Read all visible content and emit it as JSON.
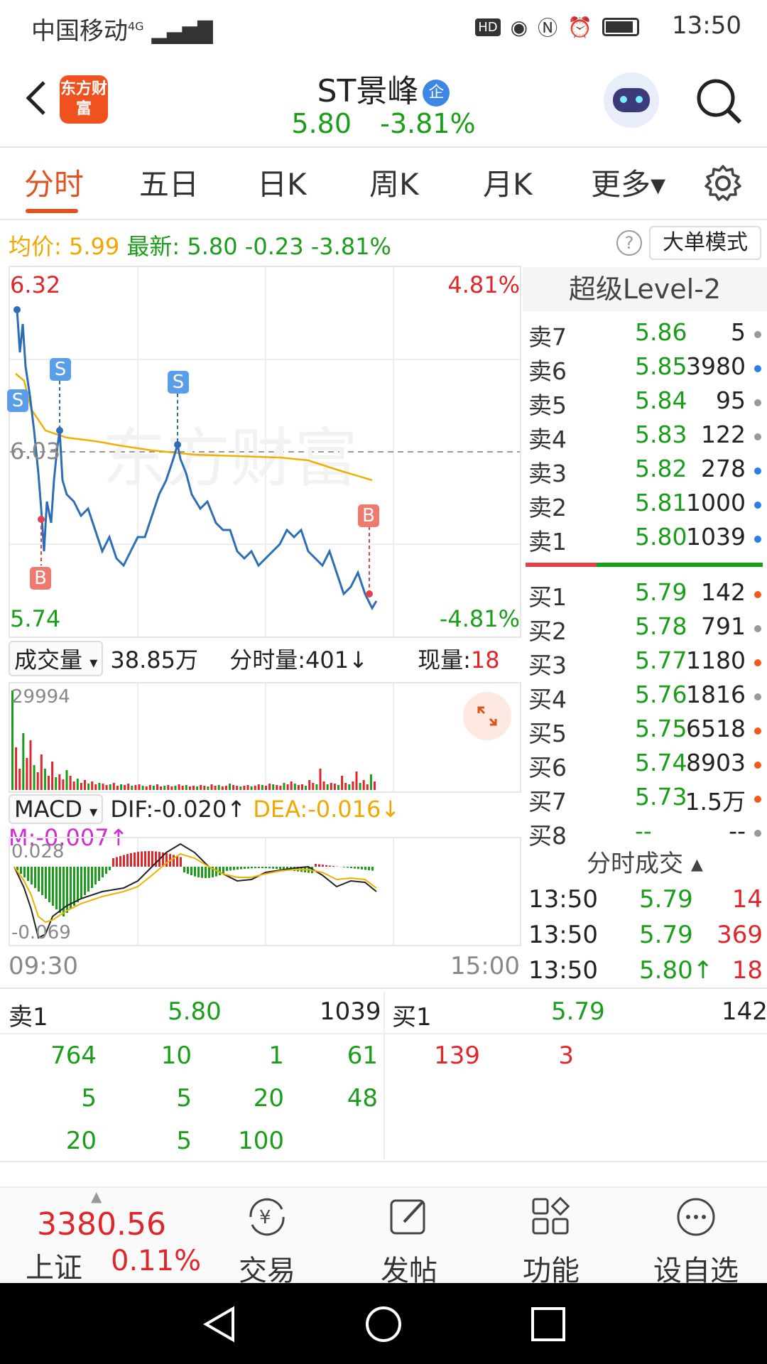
{
  "status_bar": {
    "carrier": "中国移动",
    "network": "4G",
    "time": "13:50"
  },
  "header": {
    "logo_text": "东方财富",
    "stock_name": "ST景峰",
    "badge": "企",
    "price": "5.80",
    "change_pct": "-3.81%"
  },
  "tabs": [
    {
      "label": "分时",
      "active": true
    },
    {
      "label": "五日"
    },
    {
      "label": "日K"
    },
    {
      "label": "周K"
    },
    {
      "label": "月K"
    },
    {
      "label": "更多▾"
    }
  ],
  "info_row": {
    "avg_label": "均价:",
    "avg_value": "5.99",
    "latest_label": "最新:",
    "latest_value": "5.80",
    "change": "-0.23",
    "change_pct": "-3.81%",
    "help": "?",
    "big_order_btn": "大单模式"
  },
  "chart": {
    "high_price": "6.32",
    "high_pct": "4.81%",
    "mid_price": "6.03",
    "low_price": "5.74",
    "low_pct": "-4.81%",
    "watermark": "东方财富",
    "markers": [
      "S",
      "S",
      "S",
      "B",
      "B"
    ],
    "time_start": "09:30",
    "time_end": "15:00"
  },
  "chart_data": {
    "type": "line",
    "series": [],
    "ylim": [
      5.74,
      6.32
    ],
    "reference": 6.03
  },
  "volume": {
    "dropdown": "成交量",
    "total": "38.85万",
    "minute_label": "分时量:",
    "minute_value": "401",
    "minute_arrow": "↓",
    "current_label": "现量:",
    "current_value": "18",
    "max_label": "29994"
  },
  "macd": {
    "dropdown": "MACD",
    "dif": "DIF:-0.020",
    "dif_arrow": "↑",
    "dea": "DEA:-0.016",
    "dea_arrow": "↓",
    "m": "M:-0.007",
    "m_arrow": "↑",
    "top_label": "0.028",
    "bottom_label": "-0.069"
  },
  "level2": {
    "title": "超级Level-2",
    "asks": [
      {
        "label": "卖7",
        "price": "5.86",
        "vol": "5",
        "dot": "#999999"
      },
      {
        "label": "卖6",
        "price": "5.85",
        "vol": "3980",
        "dot": "#2f7de1"
      },
      {
        "label": "卖5",
        "price": "5.84",
        "vol": "95",
        "dot": "#999999"
      },
      {
        "label": "卖4",
        "price": "5.83",
        "vol": "122",
        "dot": "#999999"
      },
      {
        "label": "卖3",
        "price": "5.82",
        "vol": "278",
        "dot": "#2f7de1"
      },
      {
        "label": "卖2",
        "price": "5.81",
        "vol": "1000",
        "dot": "#2f7de1"
      },
      {
        "label": "卖1",
        "price": "5.80",
        "vol": "1039",
        "dot": "#2f7de1"
      }
    ],
    "bids": [
      {
        "label": "买1",
        "price": "5.79",
        "vol": "142",
        "dot": "#ee5a1c"
      },
      {
        "label": "买2",
        "price": "5.78",
        "vol": "791",
        "dot": "#999999"
      },
      {
        "label": "买3",
        "price": "5.77",
        "vol": "1180",
        "dot": "#ee5a1c"
      },
      {
        "label": "买4",
        "price": "5.76",
        "vol": "1816",
        "dot": "#999999"
      },
      {
        "label": "买5",
        "price": "5.75",
        "vol": "6518",
        "dot": "#ee5a1c"
      },
      {
        "label": "买6",
        "price": "5.74",
        "vol": "8903",
        "dot": "#ee5a1c"
      },
      {
        "label": "买7",
        "price": "5.73",
        "vol": "1.5万",
        "dot": "#ee5a1c"
      },
      {
        "label": "买8",
        "price": "--",
        "vol": "--",
        "dot": "#999999"
      }
    ]
  },
  "trades": {
    "title": "分时成交",
    "rows": [
      {
        "time": "13:50",
        "price": "5.79",
        "vol": "14"
      },
      {
        "time": "13:50",
        "price": "5.79",
        "vol": "369"
      },
      {
        "time": "13:50",
        "price": "5.80↑",
        "vol": "18"
      }
    ]
  },
  "queue": {
    "sell_label": "卖1",
    "sell_price": "5.80",
    "sell_vol": "1039",
    "buy_label": "买1",
    "buy_price": "5.79",
    "buy_vol": "142",
    "sell_orders": [
      [
        "764",
        "10",
        "1",
        "61"
      ],
      [
        "5",
        "5",
        "20",
        "48"
      ],
      [
        "20",
        "5",
        "100",
        ""
      ]
    ],
    "buy_orders": [
      "139",
      "3"
    ]
  },
  "bottom_bar": {
    "index_value": "3380.56",
    "index_name": "上证",
    "index_pct": "0.11%",
    "buttons": [
      "交易",
      "发帖",
      "功能",
      "设自选"
    ]
  }
}
